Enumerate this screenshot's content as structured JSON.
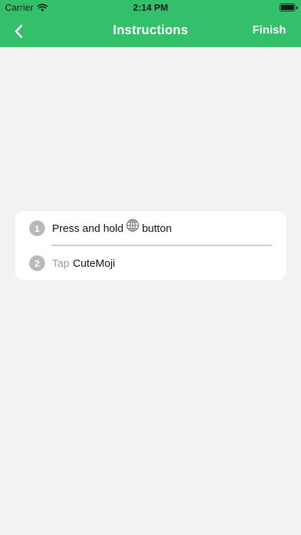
{
  "status_bar": {
    "carrier": "Carrier",
    "time": "2:14 PM",
    "icons": [
      "wifi-icon",
      "battery-icon"
    ]
  },
  "nav": {
    "title": "Instructions",
    "finish_label": "Finish",
    "back_icon": "chevron-left-icon"
  },
  "steps": [
    {
      "number": "1",
      "text_before": "Press and hold",
      "icon": "globe-icon",
      "text_after": "button"
    },
    {
      "number": "2",
      "tap_label": "Tap",
      "app_name": "CuteMoji"
    }
  ],
  "colors": {
    "accent": "#34c06a",
    "background": "#f2f2f2",
    "card": "#ffffff",
    "badge": "#b9b9b9",
    "muted_text": "#9a9a9a"
  }
}
